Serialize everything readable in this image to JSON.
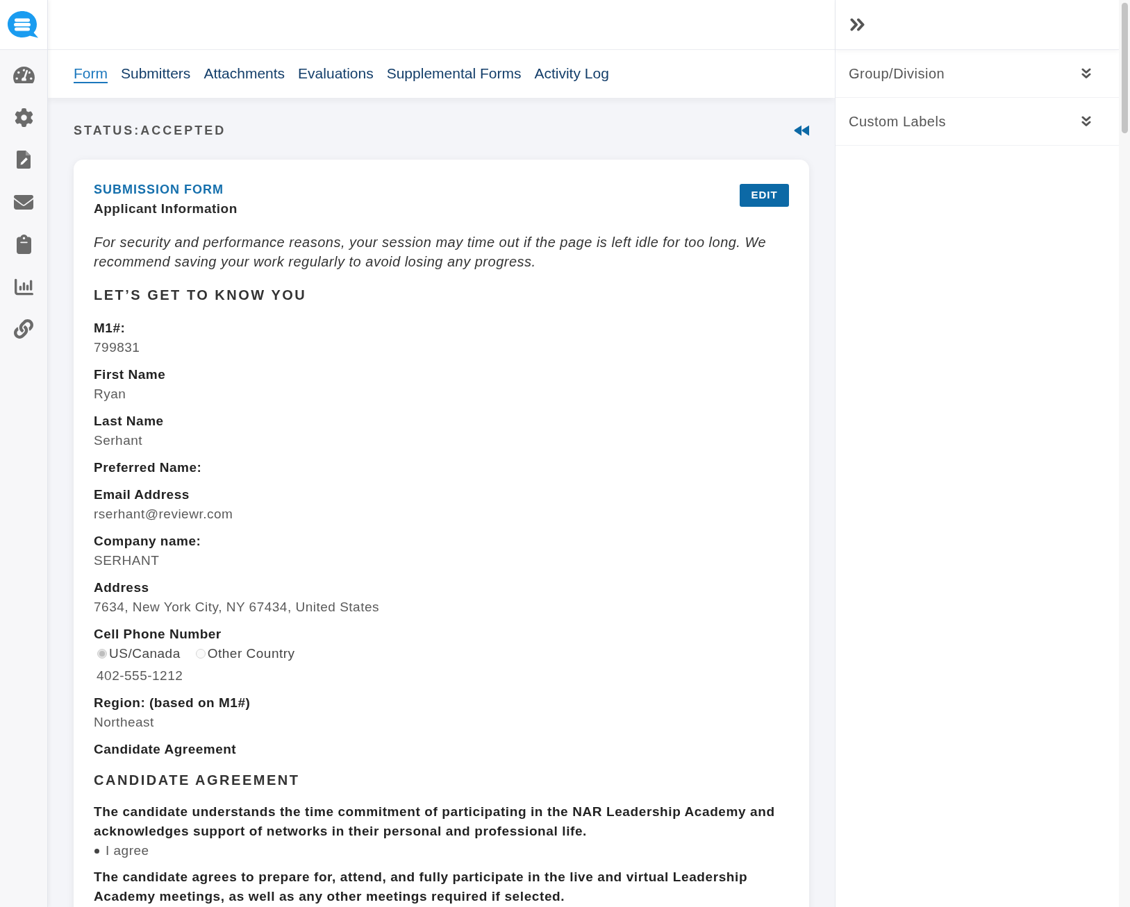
{
  "tabs": [
    {
      "label": "Form",
      "selected": true
    },
    {
      "label": "Submitters",
      "selected": false
    },
    {
      "label": "Attachments",
      "selected": false
    },
    {
      "label": "Evaluations",
      "selected": false
    },
    {
      "label": "Supplemental Forms",
      "selected": false
    },
    {
      "label": "Activity Log",
      "selected": false
    }
  ],
  "status": "STATUS:ACCEPTED",
  "form": {
    "section_label": "SUBMISSION FORM",
    "title": "Applicant Information",
    "edit_button": "EDIT",
    "notice": "For security and performance reasons, your session may time out if the page is left idle for too long. We recommend saving your work regularly to avoid losing any progress.",
    "sections": [
      {
        "heading": "LET’S GET TO KNOW YOU",
        "fields": [
          {
            "kind": "text",
            "label": "M1#:",
            "value": "799831"
          },
          {
            "kind": "text",
            "label": "First Name",
            "value": "Ryan"
          },
          {
            "kind": "text",
            "label": "Last Name",
            "value": "Serhant"
          },
          {
            "kind": "text",
            "label": "Preferred Name:"
          },
          {
            "kind": "text",
            "label": "Email Address",
            "value": "rserhant@reviewr.com"
          },
          {
            "kind": "text",
            "label": "Company name:",
            "value": "SERHANT"
          },
          {
            "kind": "text",
            "label": "Address",
            "value": "7634, New York City, NY 67434, United States"
          },
          {
            "kind": "phone",
            "label": "Cell Phone Number",
            "options": [
              {
                "label": "US/Canada",
                "selected": true
              },
              {
                "label": "Other Country",
                "selected": false
              }
            ],
            "value": "402-555-1212"
          },
          {
            "kind": "text",
            "label": "Region: (based on M1#)",
            "value": "Northeast"
          },
          {
            "kind": "text",
            "label": "Candidate Agreement"
          }
        ]
      },
      {
        "heading": "CANDIDATE AGREEMENT",
        "fields": [
          {
            "kind": "statement",
            "label": "The candidate understands the time commitment of participating in the NAR Leadership Academy and acknowledges support of networks in their personal and professional life.",
            "answers": [
              "I agree"
            ]
          },
          {
            "kind": "statement",
            "label": "The candidate agrees to prepare for, attend, and fully participate in the live and virtual Leadership Academy meetings, as well as any other meetings required if selected."
          }
        ]
      }
    ]
  },
  "side_panel": {
    "sections": [
      {
        "label": "Group/Division",
        "expanded": false
      },
      {
        "label": "Custom Labels",
        "expanded": false
      }
    ]
  }
}
